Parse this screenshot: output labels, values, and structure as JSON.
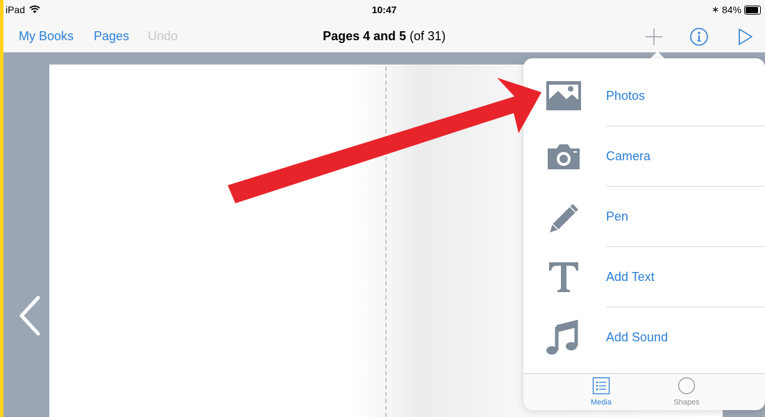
{
  "status_bar": {
    "device": "iPad",
    "time": "10:47",
    "battery": "84%",
    "battery_level": 0.84
  },
  "nav": {
    "my_books": "My Books",
    "pages": "Pages",
    "undo": "Undo",
    "title_bold": "Pages 4 and 5",
    "title_rest": " (of 31)",
    "icons": [
      "plus-icon",
      "info-icon",
      "play-icon"
    ]
  },
  "popover": {
    "items": [
      {
        "label": "Photos",
        "icon": "photo-icon"
      },
      {
        "label": "Camera",
        "icon": "camera-icon"
      },
      {
        "label": "Pen",
        "icon": "pen-icon"
      },
      {
        "label": "Add Text",
        "icon": "text-icon"
      },
      {
        "label": "Add Sound",
        "icon": "music-note-icon"
      }
    ],
    "tabs": [
      {
        "label": "Media",
        "icon": "list-icon",
        "active": true
      },
      {
        "label": "Shapes",
        "icon": "circle-icon",
        "active": false
      }
    ]
  },
  "colors": {
    "accent": "#2b7fd6",
    "frame": "#ffd21f",
    "background": "#9aa6b3",
    "arrow": "#e8242b",
    "icon_gray": "#7d8a99"
  }
}
